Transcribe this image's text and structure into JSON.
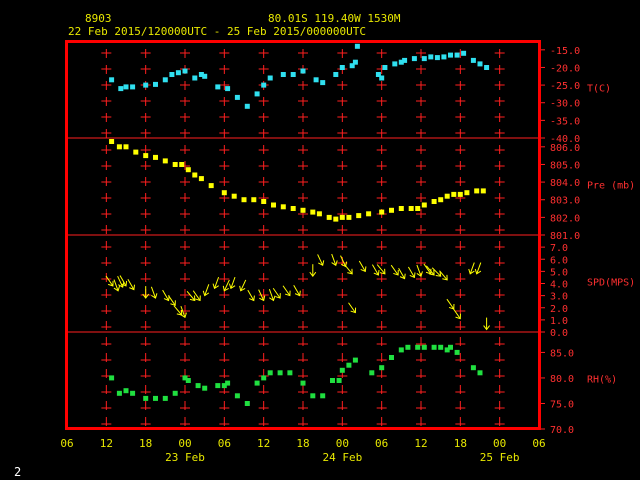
{
  "header": {
    "station": "8903",
    "location": "80.01S   119.40W   1530M",
    "range": "22 Feb 2015/120000UTC - 25 Feb 2015/000000UTC"
  },
  "footer": {
    "page": "2"
  },
  "colors": {
    "background": "#000000",
    "frame": "#ff0000",
    "grid": "#ff2020",
    "label": "#e8e800",
    "temperature": "#30e0f0",
    "pressure": "#ffff00",
    "wind": "#ffff00",
    "rh": "#20e040"
  },
  "chart_data": {
    "type": "scatter",
    "x_axis": {
      "unit": "hours since 22 Feb 2015 06 UTC",
      "range": [
        0,
        72
      ],
      "tick_labels": [
        "06",
        "12",
        "18",
        "00",
        "06",
        "12",
        "18",
        "00",
        "06",
        "12",
        "18",
        "00",
        "06"
      ],
      "tick_values": [
        0,
        6,
        12,
        18,
        24,
        30,
        36,
        42,
        48,
        54,
        60,
        66,
        72
      ],
      "date_labels": [
        {
          "x": 18,
          "label": "23 Feb"
        },
        {
          "x": 42,
          "label": "24 Feb"
        },
        {
          "x": 66,
          "label": "25 Feb"
        }
      ]
    },
    "panels": [
      {
        "id": "temperature",
        "label": "T(C)",
        "ylim": [
          -40.0,
          -12.5
        ],
        "ticks": [
          -15.0,
          -20.0,
          -25.0,
          -30.0,
          -35.0,
          -40.0
        ],
        "tick_labels": [
          "-15.0",
          "-20.0",
          "-25.0",
          "-30.0",
          "-35.0",
          "-40.0"
        ],
        "color": "#30e0f0",
        "points": [
          [
            6.8,
            -23.5
          ],
          [
            8.2,
            -26
          ],
          [
            9.0,
            -25.5
          ],
          [
            10.0,
            -25.5
          ],
          [
            12.0,
            -25
          ],
          [
            13.5,
            -24.8
          ],
          [
            15.0,
            -23.5
          ],
          [
            16.0,
            -22
          ],
          [
            17.0,
            -21.5
          ],
          [
            18.0,
            -21
          ],
          [
            19.5,
            -23
          ],
          [
            20.5,
            -22
          ],
          [
            21.0,
            -22.5
          ],
          [
            23.0,
            -25.5
          ],
          [
            24.5,
            -26
          ],
          [
            26.0,
            -28.5
          ],
          [
            27.5,
            -31
          ],
          [
            29.0,
            -27.5
          ],
          [
            30.0,
            -25
          ],
          [
            31.0,
            -23
          ],
          [
            33.0,
            -22
          ],
          [
            34.5,
            -22
          ],
          [
            36.0,
            -21
          ],
          [
            38.0,
            -23.5
          ],
          [
            39.0,
            -24.3
          ],
          [
            41.0,
            -22
          ],
          [
            42.0,
            -20
          ],
          [
            43.5,
            -19.5
          ],
          [
            44.0,
            -18.5
          ],
          [
            44.3,
            -14
          ],
          [
            47.5,
            -22
          ],
          [
            48.0,
            -23
          ],
          [
            48.5,
            -20
          ],
          [
            50.0,
            -19
          ],
          [
            51.0,
            -18.5
          ],
          [
            51.5,
            -18
          ],
          [
            53.0,
            -17.5
          ],
          [
            54.5,
            -17.5
          ],
          [
            55.5,
            -17
          ],
          [
            56.5,
            -17.2
          ],
          [
            57.5,
            -17
          ],
          [
            58.5,
            -16.5
          ],
          [
            59.5,
            -16.5
          ],
          [
            60.5,
            -16
          ],
          [
            62.0,
            -18
          ],
          [
            63.0,
            -19
          ],
          [
            64.0,
            -20
          ]
        ]
      },
      {
        "id": "pressure",
        "label": "Pre (mb)",
        "ylim": [
          801.0,
          806.5
        ],
        "ticks": [
          806.0,
          805.0,
          804.0,
          803.0,
          802.0,
          801.0
        ],
        "tick_labels": [
          "806.0",
          "805.0",
          "804.0",
          "803.0",
          "802.0",
          "801.0"
        ],
        "color": "#ffff00",
        "points": [
          [
            6.8,
            806.3
          ],
          [
            8.0,
            806.0
          ],
          [
            9.0,
            806.0
          ],
          [
            10.5,
            805.7
          ],
          [
            12.0,
            805.5
          ],
          [
            13.5,
            805.4
          ],
          [
            15.0,
            805.2
          ],
          [
            16.5,
            805.0
          ],
          [
            17.5,
            805.0
          ],
          [
            18.5,
            804.7
          ],
          [
            19.5,
            804.4
          ],
          [
            20.5,
            804.2
          ],
          [
            22.0,
            803.8
          ],
          [
            24.0,
            803.4
          ],
          [
            25.5,
            803.2
          ],
          [
            27.0,
            803.0
          ],
          [
            28.5,
            803.0
          ],
          [
            30.0,
            802.9
          ],
          [
            31.5,
            802.7
          ],
          [
            33.0,
            802.6
          ],
          [
            34.5,
            802.5
          ],
          [
            36.0,
            802.4
          ],
          [
            37.5,
            802.3
          ],
          [
            38.5,
            802.2
          ],
          [
            40.0,
            802.0
          ],
          [
            41.0,
            801.9
          ],
          [
            42.0,
            802.0
          ],
          [
            43.0,
            802.0
          ],
          [
            44.5,
            802.1
          ],
          [
            46.0,
            802.2
          ],
          [
            48.0,
            802.3
          ],
          [
            49.5,
            802.4
          ],
          [
            51.0,
            802.5
          ],
          [
            52.5,
            802.5
          ],
          [
            53.5,
            802.5
          ],
          [
            54.5,
            802.7
          ],
          [
            56.0,
            802.9
          ],
          [
            57.0,
            803.0
          ],
          [
            58.0,
            803.2
          ],
          [
            59.0,
            803.3
          ],
          [
            60.0,
            803.3
          ],
          [
            61.0,
            803.4
          ],
          [
            62.5,
            803.5
          ],
          [
            63.5,
            803.5
          ]
        ]
      },
      {
        "id": "wind",
        "label": "SPD(MPS)",
        "ylim": [
          0.0,
          8.0
        ],
        "ticks": [
          7.0,
          6.0,
          5.0,
          4.0,
          3.0,
          2.0,
          1.0,
          0.0
        ],
        "tick_labels": [
          "7.0",
          "6.0",
          "5.0",
          "4.0",
          "3.0",
          "2.0",
          "1.0",
          "0.0"
        ],
        "color": "#ffff00",
        "note": "arrow glyphs: [hours, speed m/s, arrow angle deg (0=down, clockwise)]",
        "points": [
          [
            7.0,
            3.8,
            -35
          ],
          [
            7.8,
            3.4,
            -20
          ],
          [
            8.5,
            3.7,
            -25
          ],
          [
            9.0,
            3.8,
            -30
          ],
          [
            10.2,
            3.5,
            -30
          ],
          [
            12.0,
            2.8,
            0
          ],
          [
            13.5,
            2.8,
            -20
          ],
          [
            15.5,
            2.6,
            -30
          ],
          [
            16.5,
            2.2,
            -35
          ],
          [
            17.5,
            1.4,
            -40
          ],
          [
            18.0,
            1.2,
            -20
          ],
          [
            19.5,
            2.6,
            -40
          ],
          [
            20.3,
            2.6,
            -35
          ],
          [
            21.0,
            3.0,
            20
          ],
          [
            22.5,
            3.6,
            20
          ],
          [
            24.0,
            3.4,
            25
          ],
          [
            25.0,
            3.6,
            20
          ],
          [
            26.5,
            3.4,
            25
          ],
          [
            28.5,
            2.6,
            -30
          ],
          [
            30.0,
            2.6,
            -25
          ],
          [
            31.5,
            2.6,
            -20
          ],
          [
            32.5,
            2.8,
            -35
          ],
          [
            34.0,
            3.0,
            -35
          ],
          [
            35.5,
            3.0,
            -30
          ],
          [
            37.5,
            4.6,
            0
          ],
          [
            39.0,
            5.5,
            -25
          ],
          [
            41.0,
            5.5,
            -20
          ],
          [
            42.5,
            5.4,
            -25
          ],
          [
            43.5,
            4.8,
            -40
          ],
          [
            44.0,
            1.6,
            -35
          ],
          [
            45.5,
            5.0,
            -30
          ],
          [
            47.5,
            4.7,
            -30
          ],
          [
            48.5,
            4.8,
            -40
          ],
          [
            50.5,
            4.7,
            -35
          ],
          [
            51.5,
            4.4,
            -30
          ],
          [
            53.0,
            4.5,
            -30
          ],
          [
            54.0,
            4.6,
            -20
          ],
          [
            55.5,
            4.8,
            -35
          ],
          [
            56.0,
            4.7,
            -40
          ],
          [
            57.0,
            4.6,
            -45
          ],
          [
            58.0,
            4.3,
            -40
          ],
          [
            59.0,
            1.9,
            -35
          ],
          [
            60.0,
            1.1,
            -35
          ],
          [
            61.5,
            4.8,
            20
          ],
          [
            62.5,
            4.8,
            20
          ],
          [
            64.0,
            0.2,
            0
          ]
        ]
      },
      {
        "id": "rh",
        "label": "RH(%)",
        "ylim": [
          70.0,
          89.0
        ],
        "ticks": [
          85.0,
          80.0,
          75.0,
          70.0
        ],
        "tick_labels": [
          "85.0",
          "80.0",
          "75.0",
          "70.0"
        ],
        "color": "#20e040",
        "points": [
          [
            6.8,
            80
          ],
          [
            8.0,
            77
          ],
          [
            9.0,
            77.5
          ],
          [
            10.0,
            77
          ],
          [
            12.0,
            76
          ],
          [
            13.5,
            76
          ],
          [
            15.0,
            76
          ],
          [
            16.5,
            77
          ],
          [
            18.0,
            80
          ],
          [
            18.5,
            79.5
          ],
          [
            20.0,
            78.5
          ],
          [
            21.0,
            78
          ],
          [
            23.0,
            78.5
          ],
          [
            24.0,
            78.5
          ],
          [
            24.5,
            79
          ],
          [
            26.0,
            76.5
          ],
          [
            27.5,
            75
          ],
          [
            29.0,
            79
          ],
          [
            30.0,
            80
          ],
          [
            31.0,
            81
          ],
          [
            32.5,
            81
          ],
          [
            34.0,
            81
          ],
          [
            36.0,
            79
          ],
          [
            37.5,
            76.5
          ],
          [
            39.0,
            76.5
          ],
          [
            40.5,
            79.5
          ],
          [
            41.5,
            79.5
          ],
          [
            42.0,
            81.5
          ],
          [
            43.0,
            82.5
          ],
          [
            44.0,
            83.5
          ],
          [
            46.5,
            81
          ],
          [
            48.0,
            82
          ],
          [
            49.5,
            84
          ],
          [
            51.0,
            85.5
          ],
          [
            52.0,
            86
          ],
          [
            53.5,
            86
          ],
          [
            54.5,
            86
          ],
          [
            56.0,
            86
          ],
          [
            57.0,
            86
          ],
          [
            58.0,
            85.5
          ],
          [
            58.5,
            86
          ],
          [
            59.5,
            85
          ],
          [
            62.0,
            82
          ],
          [
            63.0,
            81
          ]
        ]
      }
    ]
  }
}
